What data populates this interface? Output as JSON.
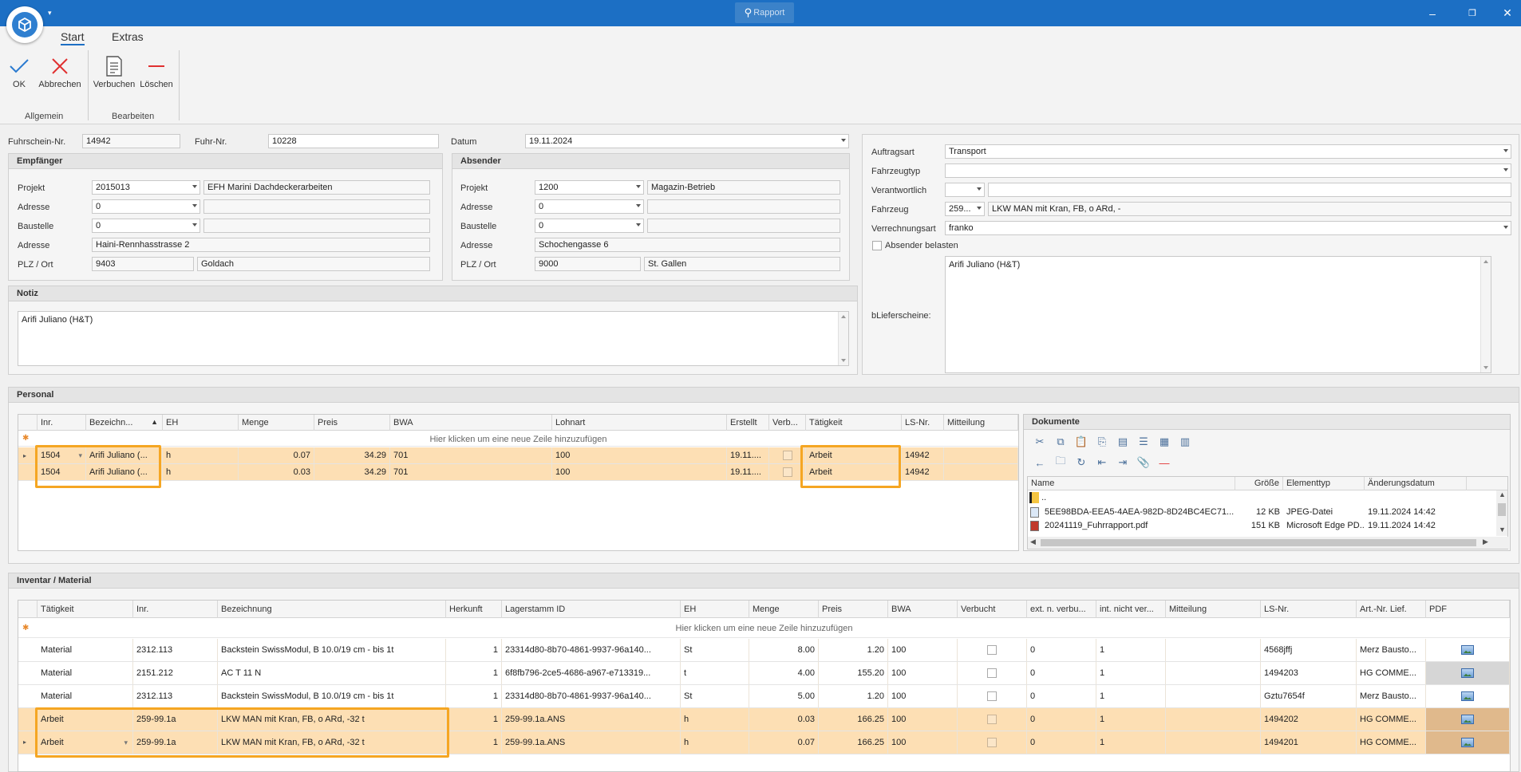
{
  "window": {
    "title": "Rapport",
    "minimize": "–",
    "restore": "❐",
    "close": "✕"
  },
  "ribbon": {
    "tabs": [
      "Start",
      "Extras"
    ],
    "ok": "OK",
    "cancel": "Abbrechen",
    "post": "Verbuchen",
    "delete": "Löschen",
    "group_general": "Allgemein",
    "group_edit": "Bearbeiten"
  },
  "header": {
    "license_label": "Fuhrschein-Nr.",
    "license_value": "14942",
    "trip_label": "Fuhr-Nr.",
    "trip_value": "10228",
    "date_label": "Datum",
    "date_value": "19.11.2024"
  },
  "recipient": {
    "title": "Empfänger",
    "project_label": "Projekt",
    "project_value": "2015013",
    "project_name": "EFH Marini Dachdeckerarbeiten",
    "address_sel_label": "Adresse",
    "address_sel_value": "0",
    "site_label": "Baustelle",
    "site_value": "0",
    "address_label": "Adresse",
    "address_value": "Haini-Rennhasstrasse 2",
    "zip_label": "PLZ / Ort",
    "zip_value": "9403",
    "city_value": "Goldach"
  },
  "sender": {
    "title": "Absender",
    "project_label": "Projekt",
    "project_value": "1200",
    "project_name": "Magazin-Betrieb",
    "address_sel_label": "Adresse",
    "address_sel_value": "0",
    "site_label": "Baustelle",
    "site_value": "0",
    "address_label": "Adresse",
    "address_value": "Schochengasse 6",
    "zip_label": "PLZ / Ort",
    "zip_value": "9000",
    "city_value": "St. Gallen"
  },
  "note": {
    "title": "Notiz",
    "text": "Arifi Juliano (H&T)"
  },
  "order": {
    "type_label": "Auftragsart",
    "type_value": "Transport",
    "vehicle_type_label": "Fahrzeugtyp",
    "vehicle_type_value": "",
    "responsible_label": "Verantwortlich",
    "vehicle_label": "Fahrzeug",
    "vehicle_code": "259...",
    "vehicle_name": "LKW MAN mit Kran, FB, o ARd, -",
    "billing_label": "Verrechnungsart",
    "billing_value": "franko",
    "charge_sender_label": "Absender belasten",
    "delivery_label": "bLieferscheine:",
    "delivery_text": "Arifi Juliano (H&T)"
  },
  "personal": {
    "title": "Personal",
    "new_row": "Hier klicken um eine neue Zeile hinzuzufügen",
    "columns": [
      "Inr.",
      "Bezeichn...",
      "EH",
      "Menge",
      "Preis",
      "BWA",
      "Lohnart",
      "Erstellt",
      "Verb...",
      "Tätigkeit",
      "LS-Nr.",
      "Mitteilung"
    ],
    "rows": [
      {
        "inr": "1504",
        "name": "Arifi Juliano (...",
        "eh": "h",
        "qty": "0.07",
        "price": "34.29",
        "bwa": "701",
        "wage": "100",
        "created": "19.11....",
        "activity": "Arbeit",
        "ls": "14942"
      },
      {
        "inr": "1504",
        "name": "Arifi Juliano (...",
        "eh": "h",
        "qty": "0.03",
        "price": "34.29",
        "bwa": "701",
        "wage": "100",
        "created": "19.11....",
        "activity": "Arbeit",
        "ls": "14942"
      }
    ]
  },
  "documents": {
    "title": "Dokumente",
    "columns": [
      "Name",
      "Größe",
      "Elementtyp",
      "Änderungsdatum"
    ],
    "parent": "..",
    "files": [
      {
        "name": "5EE98BDA-EEA5-4AEA-982D-8D24BC4EC71...",
        "size": "12 KB",
        "type": "JPEG-Datei",
        "date": "19.11.2024 14:42"
      },
      {
        "name": "20241119_Fuhrrapport.pdf",
        "size": "151 KB",
        "type": "Microsoft Edge PD...",
        "date": "19.11.2024 14:42"
      }
    ]
  },
  "inventory": {
    "title": "Inventar / Material",
    "new_row": "Hier klicken um eine neue Zeile hinzuzufügen",
    "columns": [
      "Tätigkeit",
      "Inr.",
      "Bezeichnung",
      "Herkunft",
      "Lagerstamm ID",
      "EH",
      "Menge",
      "Preis",
      "BWA",
      "Verbucht",
      "ext. n. verbu...",
      "int. nicht ver...",
      "Mitteilung",
      "LS-Nr.",
      "Art.-Nr. Lief.",
      "PDF"
    ],
    "rows": [
      {
        "act": "Material",
        "inr": "2312.113",
        "name": "Backstein SwissModul, B 10.0/19 cm - bis 1t",
        "origin": "1",
        "stock": "23314d80-8b70-4861-9937-96a140...",
        "eh": "St",
        "qty": "8.00",
        "price": "1.20",
        "bwa": "100",
        "ext": "0",
        "int": "1",
        "ls": "4568jffj",
        "art": "Merz Bausto..."
      },
      {
        "act": "Material",
        "inr": "2151.212",
        "name": "AC T 11 N",
        "origin": "1",
        "stock": "6f8fb796-2ce5-4686-a967-e713319...",
        "eh": "t",
        "qty": "4.00",
        "price": "155.20",
        "bwa": "100",
        "ext": "0",
        "int": "1",
        "ls": "1494203",
        "art": "HG COMME..."
      },
      {
        "act": "Material",
        "inr": "2312.113",
        "name": "Backstein SwissModul, B 10.0/19 cm - bis 1t",
        "origin": "1",
        "stock": "23314d80-8b70-4861-9937-96a140...",
        "eh": "St",
        "qty": "5.00",
        "price": "1.20",
        "bwa": "100",
        "ext": "0",
        "int": "1",
        "ls": "Gztu7654f",
        "art": "Merz Bausto..."
      },
      {
        "act": "Arbeit",
        "inr": "259-99.1a",
        "name": "LKW MAN mit Kran, FB, o ARd, -32 t",
        "origin": "1",
        "stock": "259-99.1a.ANS",
        "eh": "h",
        "qty": "0.03",
        "price": "166.25",
        "bwa": "100",
        "ext": "0",
        "int": "1",
        "ls": "1494202",
        "art": "HG COMME..."
      },
      {
        "act": "Arbeit",
        "inr": "259-99.1a",
        "name": "LKW MAN mit Kran, FB, o ARd, -32 t",
        "origin": "1",
        "stock": "259-99.1a.ANS",
        "eh": "h",
        "qty": "0.07",
        "price": "166.25",
        "bwa": "100",
        "ext": "0",
        "int": "1",
        "ls": "1494201",
        "art": "HG COMME..."
      }
    ]
  },
  "colors": {
    "titlebar": "#1c6fc4",
    "selection": "#fddfb4",
    "highlight": "#f5a623"
  }
}
